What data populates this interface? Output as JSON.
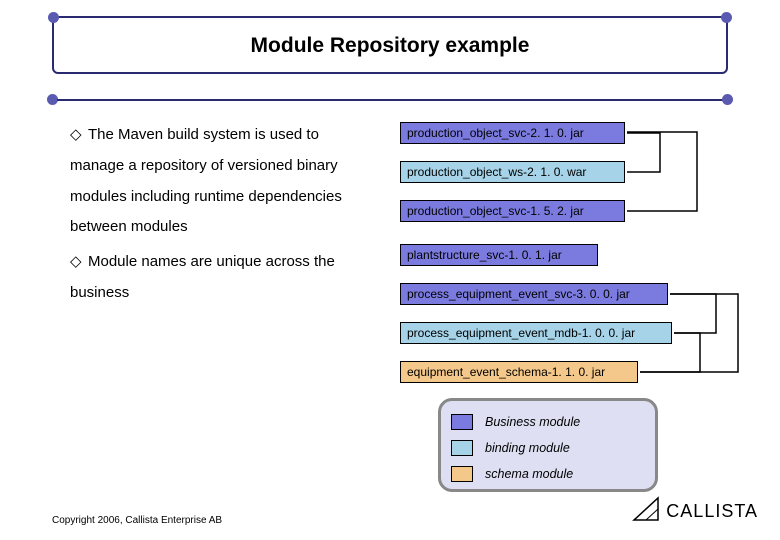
{
  "title": "Module Repository example",
  "bullets": [
    "The Maven build system is used to manage a repository of versioned binary modules including runtime dependencies between modules",
    "Module names are unique across the business"
  ],
  "modules": [
    {
      "label": "production_object_svc-2. 1. 0. jar",
      "type": "biz"
    },
    {
      "label": "production_object_ws-2. 1. 0. war",
      "type": "bind"
    },
    {
      "label": "production_object_svc-1. 5. 2. jar",
      "type": "biz"
    },
    {
      "label": "plantstructure_svc-1. 0. 1. jar",
      "type": "biz"
    },
    {
      "label": "process_equipment_event_svc-3. 0. 0. jar",
      "type": "biz"
    },
    {
      "label": "process_equipment_event_mdb-1. 0. 0. jar",
      "type": "bind"
    },
    {
      "label": "equipment_event_schema-1. 1. 0. jar",
      "type": "schema"
    }
  ],
  "legend": [
    {
      "label": "Business module",
      "type": "biz"
    },
    {
      "label": "binding module",
      "type": "bind"
    },
    {
      "label": "schema module",
      "type": "schema"
    }
  ],
  "copyright": "Copyright 2006, Callista Enterprise AB",
  "logo": "CALLISTA"
}
